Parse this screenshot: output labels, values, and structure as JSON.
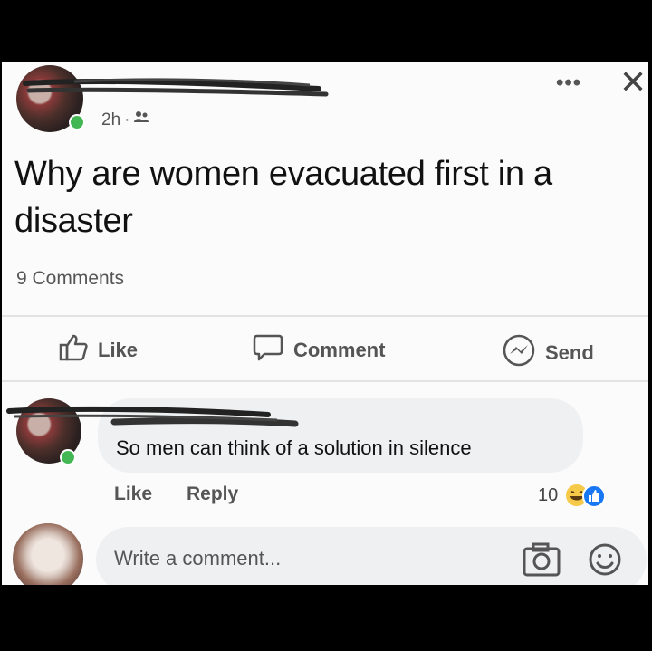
{
  "post": {
    "time": "2h",
    "separator": "·",
    "audience_icon": "friends-icon",
    "text": "Why are women evacuated first in a disaster",
    "comments_count": "9 Comments"
  },
  "actions": {
    "like": "Like",
    "comment": "Comment",
    "send": "Send"
  },
  "comment": {
    "text": "So men can think of a solution in silence",
    "like": "Like",
    "reply": "Reply",
    "reactions_count": "10",
    "reaction_icons": [
      "laugh-reaction-icon",
      "like-reaction-icon"
    ]
  },
  "composer": {
    "placeholder": "Write a comment...",
    "camera_icon": "camera-icon",
    "emoji_icon": "emoji-icon"
  },
  "colors": {
    "online": "#44b755",
    "like_blue": "#1877f2",
    "haha_yellow": "#f7c948"
  }
}
